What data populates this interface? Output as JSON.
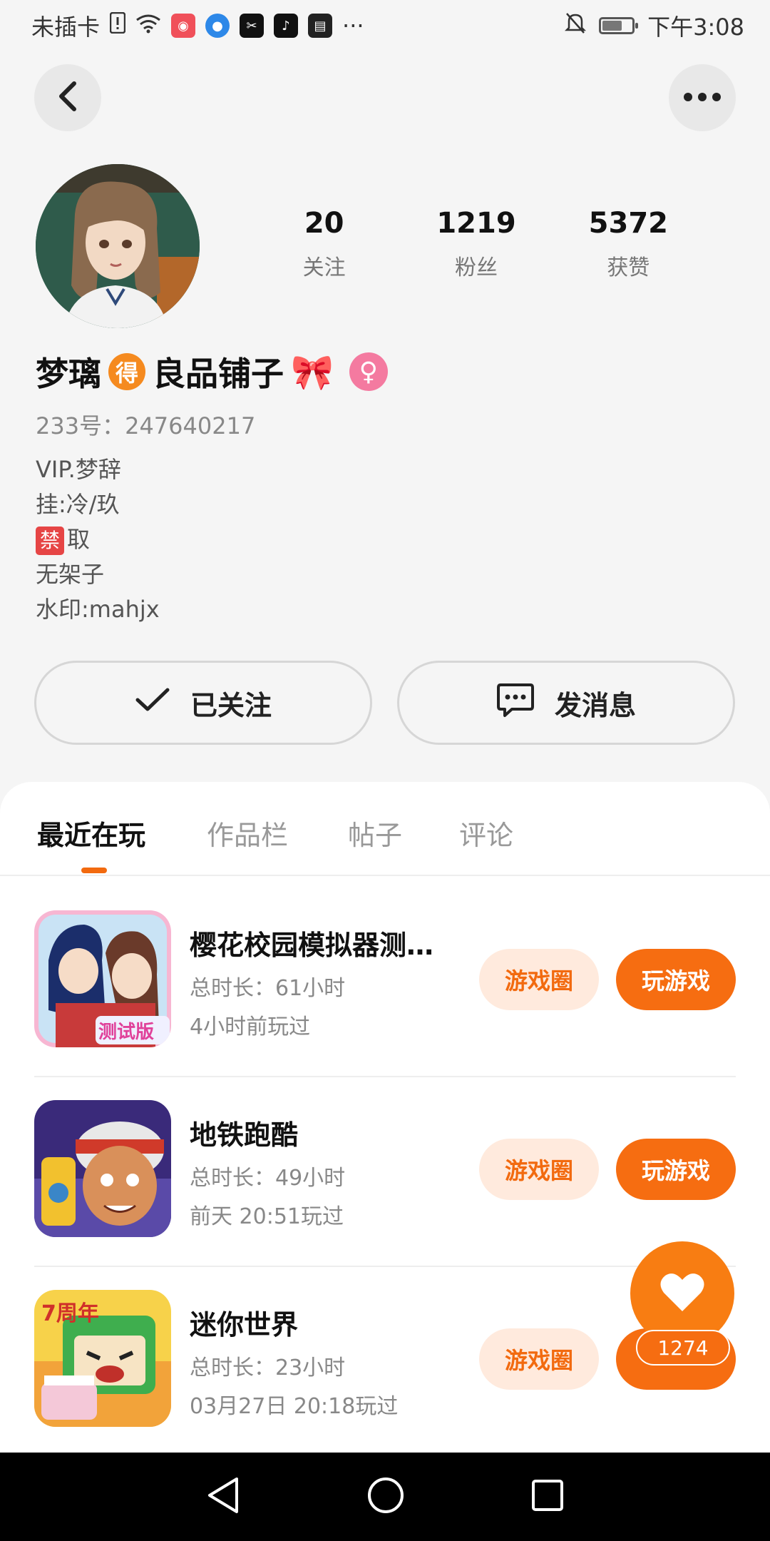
{
  "status_bar": {
    "carrier": "未插卡",
    "time": "下午3:08",
    "more": "···"
  },
  "profile": {
    "stats": [
      {
        "num": "20",
        "label": "关注"
      },
      {
        "num": "1219",
        "label": "粉丝"
      },
      {
        "num": "5372",
        "label": "获赞"
      }
    ],
    "name_part1": "梦璃",
    "name_badge": "得",
    "name_part2": "良品铺子",
    "id_label": "233号：247640217",
    "bio": [
      "VIP.梦辞",
      "挂:冷/玖",
      "禁",
      "取",
      "无架子",
      "水印:mahjx"
    ],
    "follow_label": "已关注",
    "message_label": "发消息"
  },
  "tabs": [
    "最近在玩",
    "作品栏",
    "帖子",
    "评论"
  ],
  "games": [
    {
      "title": "樱花校园模拟器测…",
      "duration": "总时长：61小时",
      "last_played": "4小时前玩过",
      "icon_badge": "测试版"
    },
    {
      "title": "地铁跑酷",
      "duration": "总时长：49小时",
      "last_played": "前天 20:51玩过"
    },
    {
      "title": "迷你世界",
      "duration": "总时长：23小时",
      "last_played": "03月27日 20:18玩过",
      "icon_badge": "7周年"
    }
  ],
  "game_buttons": {
    "circle": "游戏圈",
    "play": "玩游戏"
  },
  "like_count": "1274",
  "colors": {
    "accent": "#f66d11",
    "accent_light": "#ffeadd",
    "gender": "#f47aa0"
  }
}
